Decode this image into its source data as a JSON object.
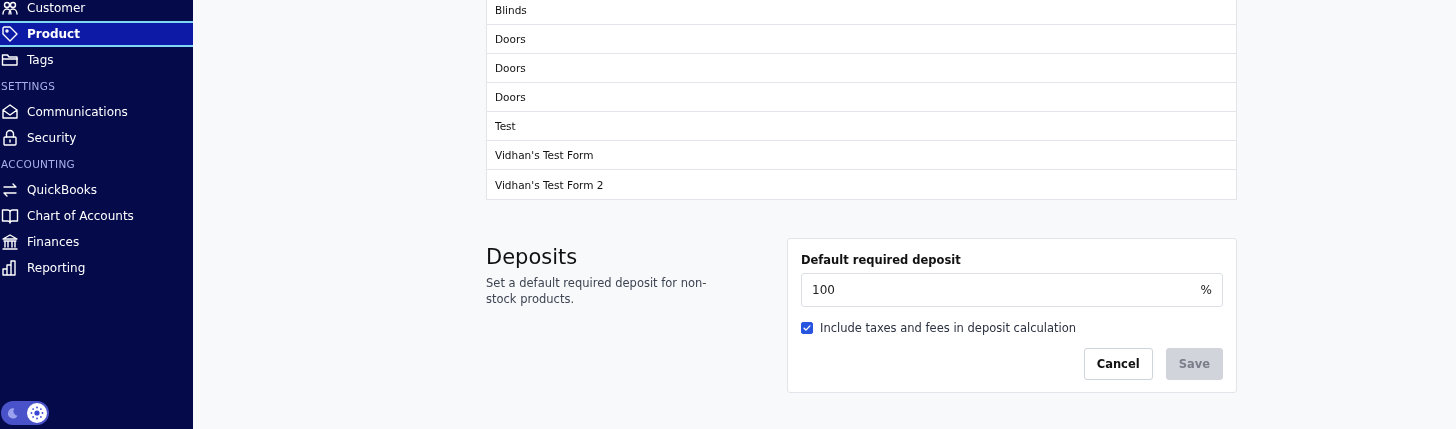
{
  "sidebar": {
    "items": [
      {
        "kind": "item",
        "label": "Customer",
        "selected": false
      },
      {
        "kind": "item",
        "label": "Product",
        "selected": true
      },
      {
        "kind": "item",
        "label": "Tags",
        "selected": false
      },
      {
        "kind": "heading",
        "label": "SETTINGS"
      },
      {
        "kind": "item",
        "label": "Communications",
        "selected": false
      },
      {
        "kind": "item",
        "label": "Security",
        "selected": false
      },
      {
        "kind": "heading",
        "label": "ACCOUNTING"
      },
      {
        "kind": "item",
        "label": "QuickBooks",
        "selected": false
      },
      {
        "kind": "item",
        "label": "Chart of Accounts",
        "selected": false
      },
      {
        "kind": "item",
        "label": "Finances",
        "selected": false
      },
      {
        "kind": "item",
        "label": "Reporting",
        "selected": false
      }
    ],
    "theme_toggle": {
      "light_mode": true
    }
  },
  "table": {
    "rows": [
      "Blinds",
      "Doors",
      "Doors",
      "Doors",
      "Test",
      "Vidhan's Test Form",
      "Vidhan's Test Form 2"
    ]
  },
  "deposits": {
    "title": "Deposits",
    "description": "Set a default required deposit for non-stock products.",
    "field": {
      "label": "Default required deposit",
      "value": "100",
      "suffix": "%"
    },
    "checkbox": {
      "label": "Include taxes and fees in deposit calculation",
      "checked": true
    },
    "buttons": [
      {
        "kind": "secondary",
        "label": "Cancel",
        "disabled": false
      },
      {
        "kind": "primary",
        "label": "Save",
        "disabled": true
      }
    ]
  }
}
